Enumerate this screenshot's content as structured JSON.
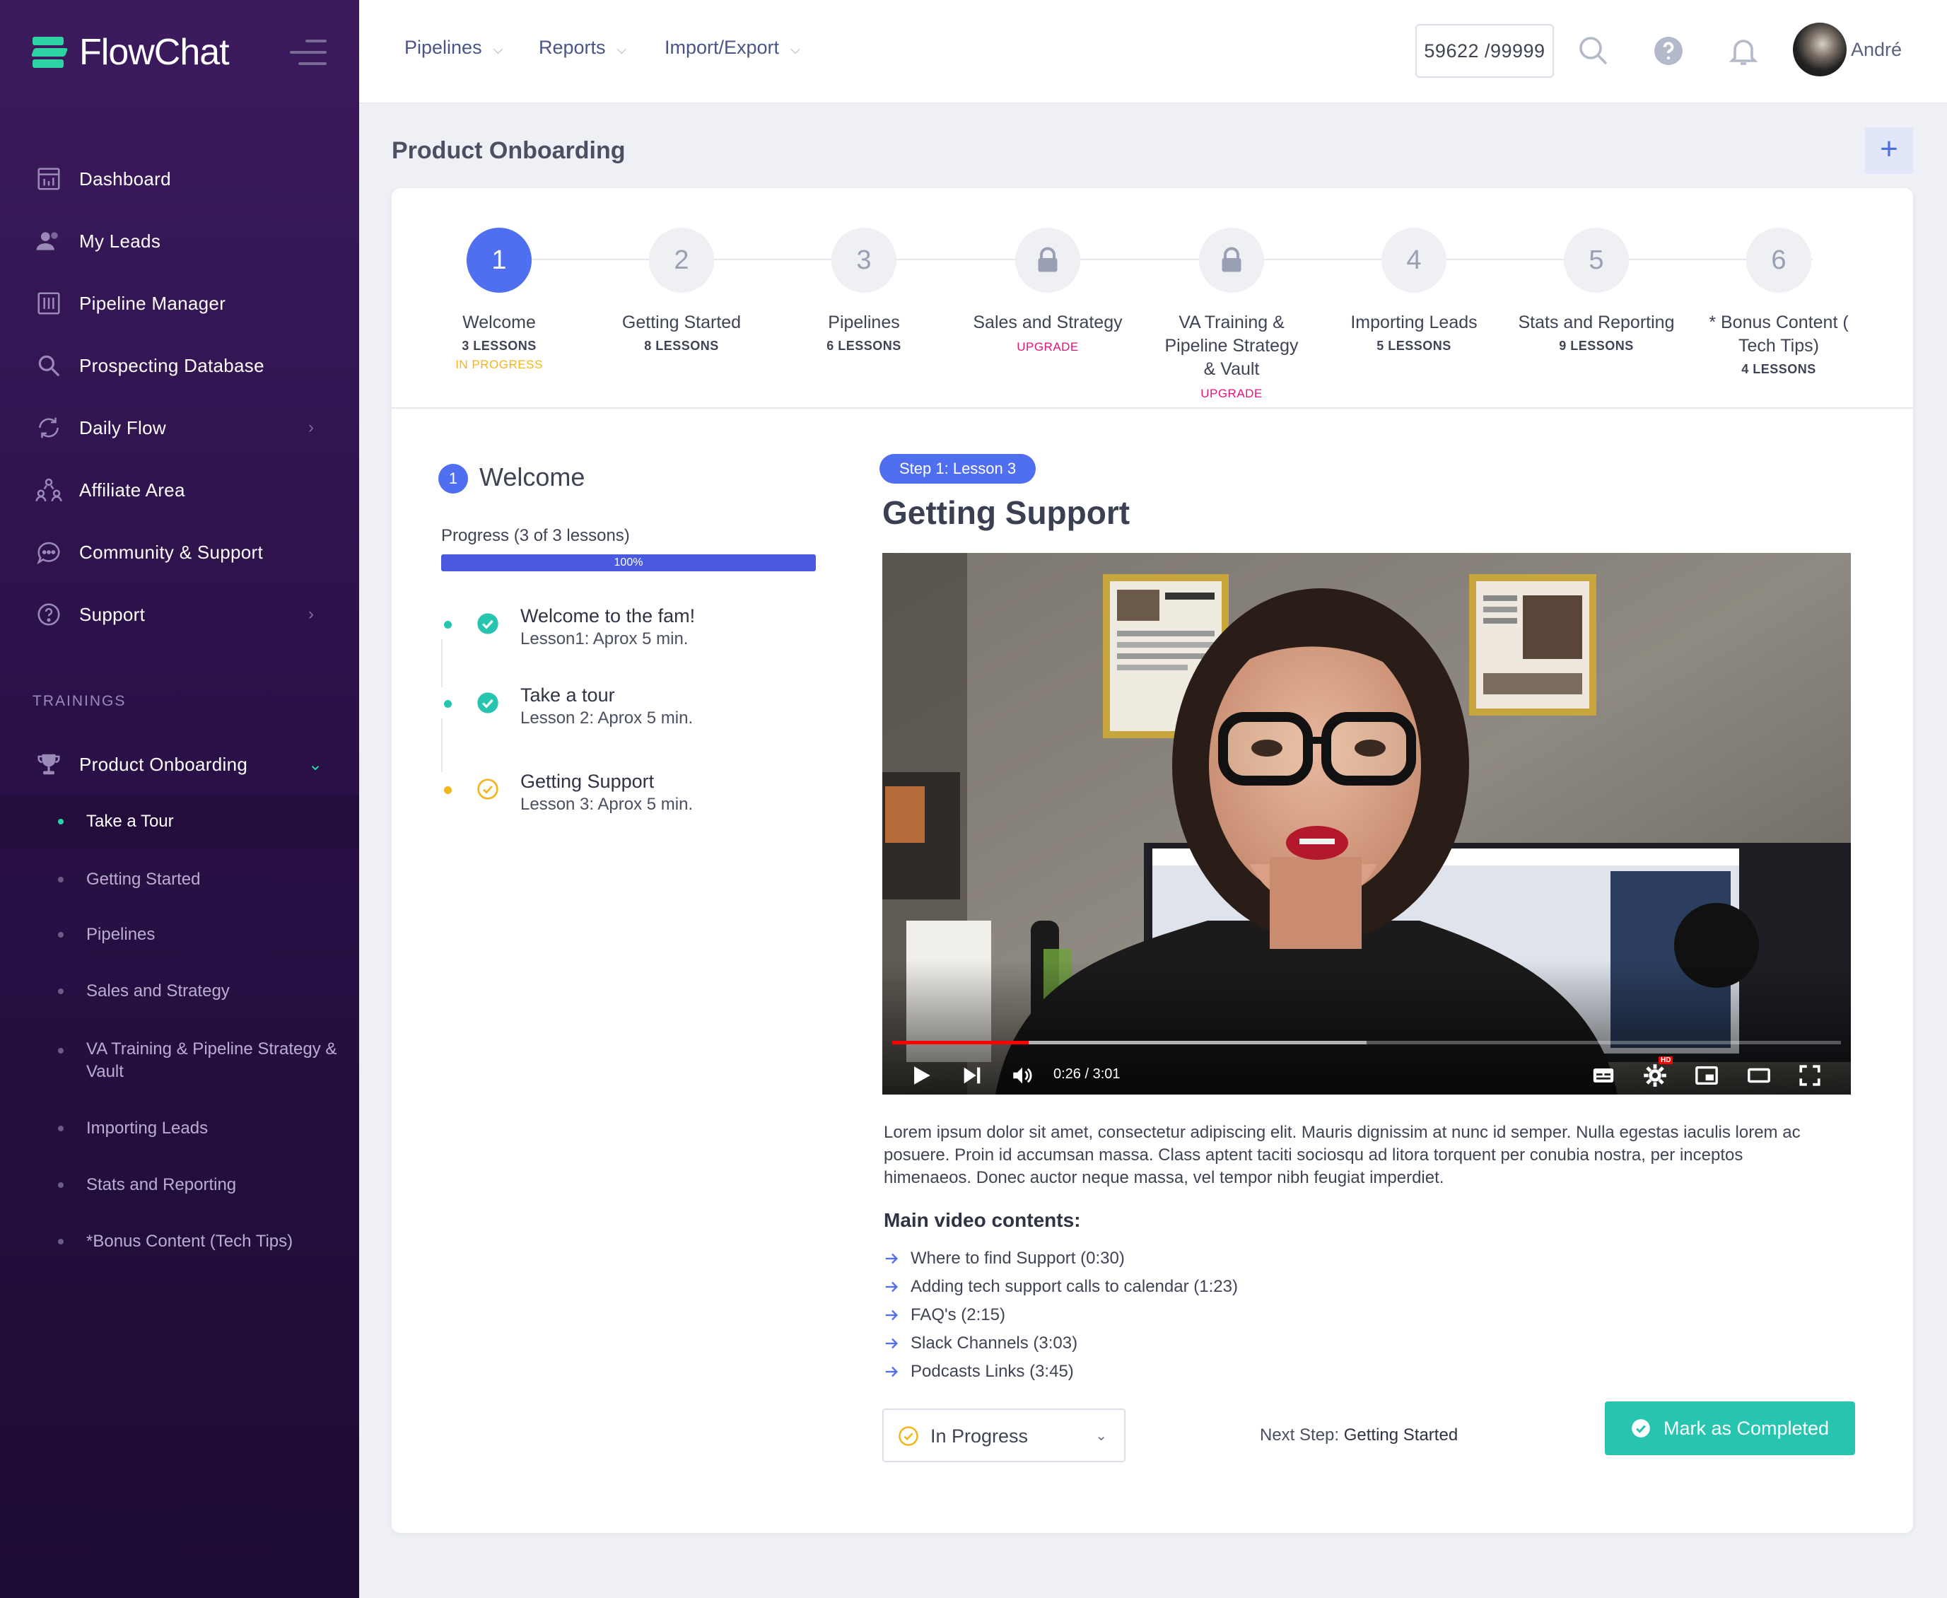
{
  "brand": {
    "name": "FlowChat",
    "accent": "#2ed3a3"
  },
  "sidebar": {
    "nav": [
      {
        "label": "Dashboard",
        "icon": "dashboard-icon"
      },
      {
        "label": "My Leads",
        "icon": "users-icon"
      },
      {
        "label": "Pipeline Manager",
        "icon": "pipeline-icon"
      },
      {
        "label": "Prospecting Database",
        "icon": "search-icon"
      },
      {
        "label": "Daily Flow",
        "icon": "refresh-icon",
        "has_children": true
      },
      {
        "label": "Affiliate Area",
        "icon": "affiliate-icon"
      },
      {
        "label": "Community & Support",
        "icon": "chat-icon"
      },
      {
        "label": "Support",
        "icon": "help-circle-icon",
        "has_children": true
      }
    ],
    "trainings_title": "TRAININGS",
    "training_group": "Product Onboarding",
    "training_items": [
      "Take a Tour",
      "Getting Started",
      "Pipelines",
      "Sales and Strategy",
      "VA Training & Pipeline Strategy & Vault",
      "Importing Leads",
      "Stats and Reporting",
      "*Bonus Content (Tech Tips)"
    ],
    "active_item": "Take a Tour"
  },
  "topbar": {
    "menus": [
      "Pipelines",
      "Reports",
      "Import/Export"
    ],
    "counter": "59622 /99999",
    "user_name": "André"
  },
  "page": {
    "title": "Product Onboarding",
    "add_label": "+"
  },
  "stepper": [
    {
      "number": "1",
      "title": "Welcome",
      "meta": "3 LESSONS",
      "status": "IN PROGRESS",
      "active": true
    },
    {
      "number": "2",
      "title": "Getting Started",
      "meta": "8 LESSONS"
    },
    {
      "number": "3",
      "title": "Pipelines",
      "meta": "6 LESSONS"
    },
    {
      "number": "",
      "title": "Sales and Strategy",
      "upgrade": "UPGRADE",
      "locked": true
    },
    {
      "number": "",
      "title": "VA Training & Pipeline Strategy & Vault",
      "upgrade": "UPGRADE",
      "locked": true
    },
    {
      "number": "4",
      "title": "Importing Leads",
      "meta": "5 LESSONS"
    },
    {
      "number": "5",
      "title": "Stats and Reporting",
      "meta": "9 LESSONS"
    },
    {
      "number": "6",
      "title": "* Bonus Content ( Tech Tips)",
      "meta": "4 LESSONS"
    }
  ],
  "module": {
    "number": "1",
    "title": "Welcome",
    "progress_label": "Progress (3 of 3 lessons)",
    "progress_percent": 100,
    "progress_text": "100%",
    "lessons": [
      {
        "title": "Welcome to the fam!",
        "sub": "Lesson1: Aprox 5 min.",
        "state": "done"
      },
      {
        "title": "Take a tour",
        "sub": "Lesson 2: Aprox 5 min.",
        "state": "done"
      },
      {
        "title": "Getting Support",
        "sub": "Lesson 3: Aprox 5 min.",
        "state": "in-progress"
      }
    ]
  },
  "lesson": {
    "step_pill": "Step 1: Lesson 3",
    "heading": "Getting Support",
    "video": {
      "time": "0:26 / 3:01",
      "played_fraction": 0.144,
      "buffered_fraction": 0.5,
      "hd_badge": "HD"
    },
    "description": "Lorem ipsum dolor sit amet, consectetur adipiscing elit. Mauris dignissim at nunc id semper. Nulla egestas iaculis lorem ac posuere. Proin id accumsan massa. Class aptent taciti sociosqu ad litora torquent per conubia nostra, per inceptos himenaeos. Donec auctor neque massa, vel tempor nibh feugiat imperdiet.",
    "contents_title": "Main video contents:",
    "contents": [
      "Where to find Support (0:30)",
      "Adding tech support calls to calendar (1:23)",
      "FAQ's (2:15)",
      "Slack Channels (3:03)",
      "Podcasts Links (3:45)"
    ],
    "status_select": "In Progress",
    "next_step_label": "Next Step:",
    "next_step_value": "Getting Started",
    "complete_label": "Mark as Completed"
  },
  "colors": {
    "primary": "#4f6ef0",
    "success": "#27c4b0",
    "warning": "#f2b51a",
    "upgrade": "#e2157a",
    "sidebar_top": "#3c1a5e",
    "sidebar_bottom": "#1c0b33"
  }
}
